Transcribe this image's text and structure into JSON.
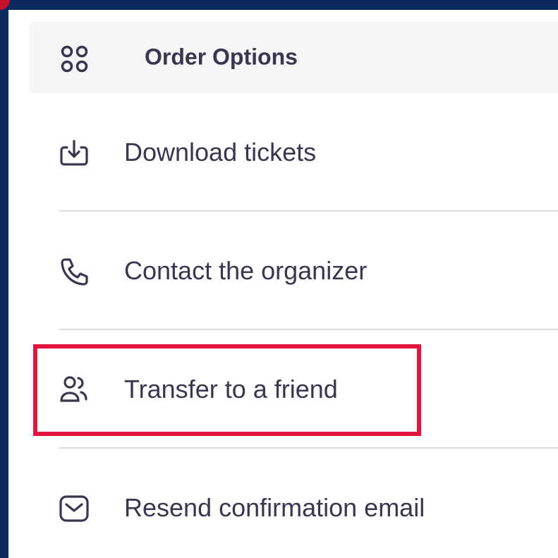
{
  "header": {
    "title": "Order Options",
    "icon": "grid-icon"
  },
  "menu": {
    "items": [
      {
        "label": "Download tickets",
        "icon": "download-icon"
      },
      {
        "label": "Contact the organizer",
        "icon": "phone-icon"
      },
      {
        "label": "Transfer to a friend",
        "icon": "users-icon",
        "highlighted": true
      },
      {
        "label": "Resend confirmation email",
        "icon": "mail-icon"
      }
    ]
  },
  "colors": {
    "text": "#39364f",
    "highlight": "#e0143c",
    "frame": "#0b2a5e",
    "header_bg": "#f5f6f8",
    "divider": "#dbdbe0"
  }
}
